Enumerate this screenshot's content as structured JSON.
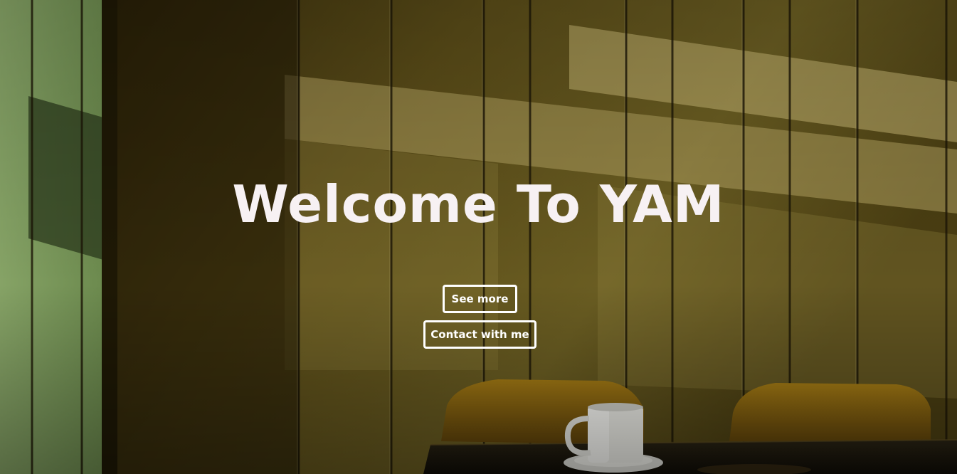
{
  "hero": {
    "title": "Welcome To YAM",
    "background": "cafe-wall-with-sunlight-coffee-cup-photo"
  },
  "buttons": {
    "see_more_label": "See more",
    "contact_label": "Contact with me"
  },
  "colors": {
    "title": "#f7f1f3",
    "button_border": "#ffffff",
    "wall": "#6e6328",
    "green_wall": "#7a9a5a"
  }
}
